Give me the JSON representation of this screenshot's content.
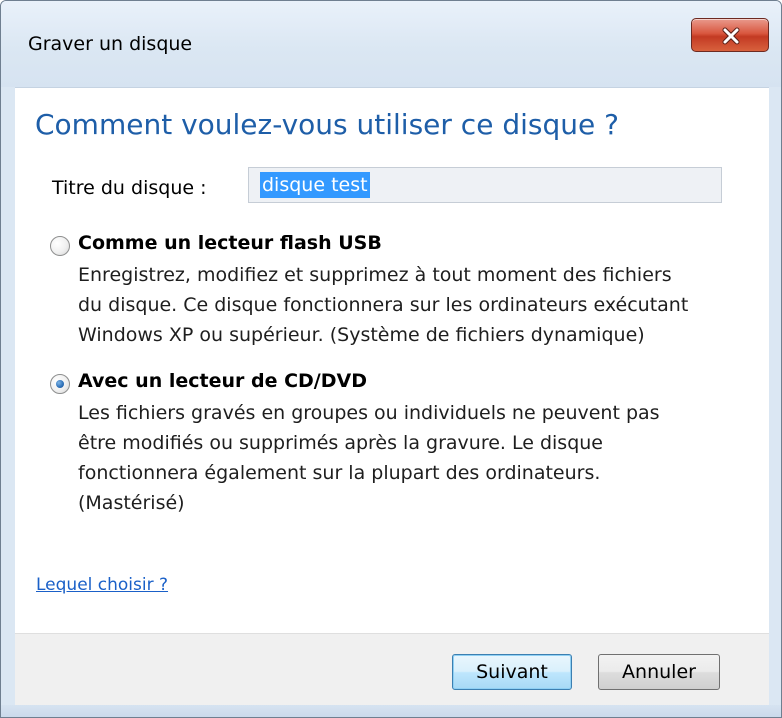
{
  "window": {
    "title": "Graver un disque"
  },
  "content": {
    "heading": "Comment voulez-vous utiliser ce disque ?",
    "disc_title_label": "Titre du disque :",
    "disc_title_value": "disque test"
  },
  "options": [
    {
      "title": "Comme un lecteur flash USB",
      "selected": false,
      "description_lines": [
        "Enregistrez, modifiez et supprimez à tout moment des fichiers",
        "du disque. Ce disque fonctionnera sur les ordinateurs exécutant",
        "Windows XP ou supérieur. (Système de fichiers dynamique)"
      ]
    },
    {
      "title": "Avec un lecteur de CD/DVD",
      "selected": true,
      "description_lines": [
        "Les fichiers gravés en groupes ou individuels ne peuvent pas",
        "être modifiés ou supprimés après la gravure. Le disque",
        "fonctionnera également sur la plupart des ordinateurs.",
        "(Mastérisé)"
      ]
    }
  ],
  "help_link": "Lequel choisir ?",
  "buttons": {
    "next": "Suivant",
    "cancel": "Annuler"
  },
  "icons": {
    "close": "close-icon"
  },
  "colors": {
    "heading": "#1e5ea8",
    "link": "#1a60c8",
    "selection": "#3399ff",
    "close_button": "#c33a23"
  }
}
